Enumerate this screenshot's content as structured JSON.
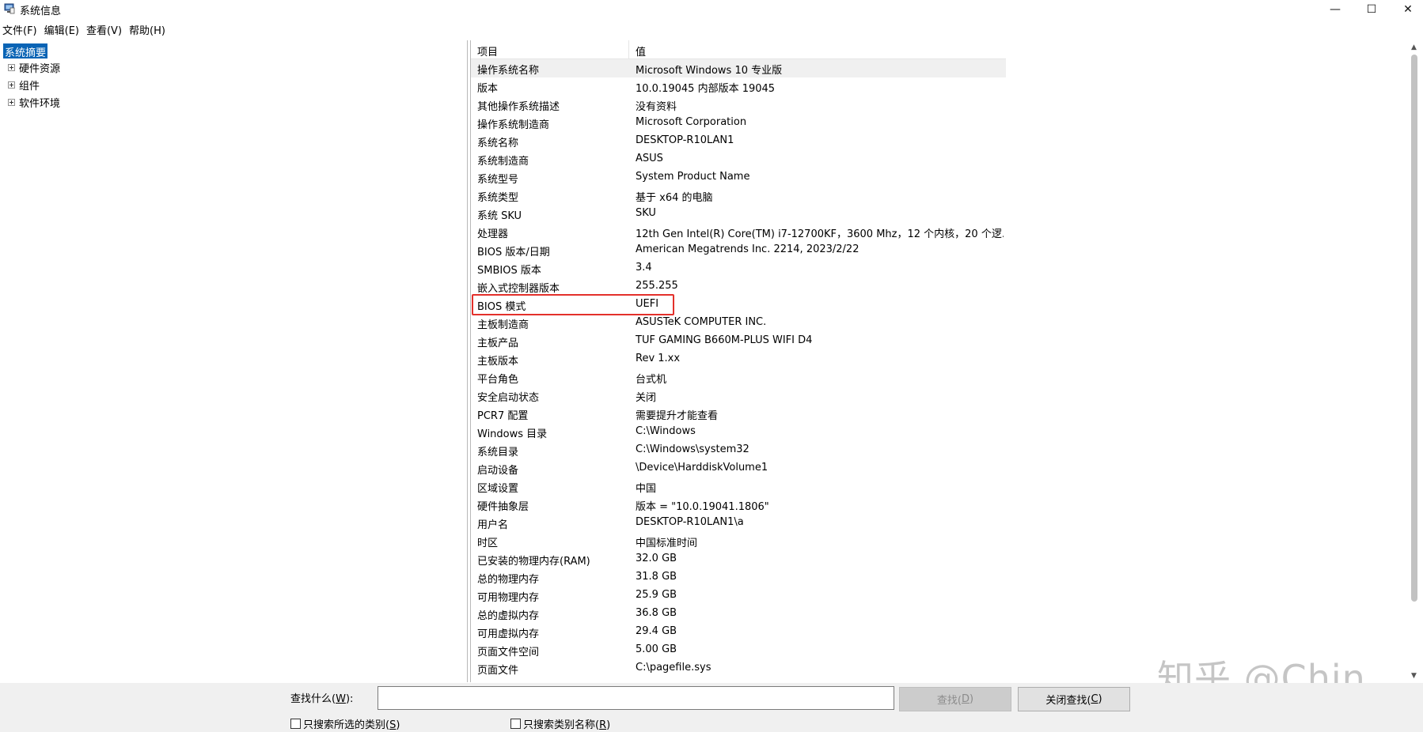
{
  "window": {
    "title": "系统信息",
    "minimize_glyph": "—",
    "maximize_glyph": "☐",
    "close_glyph": "✕"
  },
  "menu": [
    {
      "label": "文件(F)"
    },
    {
      "label": "编辑(E)"
    },
    {
      "label": "查看(V)"
    },
    {
      "label": "帮助(H)"
    }
  ],
  "tree": {
    "root": "系统摘要",
    "nodes": [
      {
        "label": "硬件资源"
      },
      {
        "label": "组件"
      },
      {
        "label": "软件环境"
      }
    ]
  },
  "table": {
    "columns": {
      "item": "项目",
      "value": "值"
    },
    "rows": [
      {
        "item": "操作系统名称",
        "value": "Microsoft Windows 10 专业版"
      },
      {
        "item": "版本",
        "value": "10.0.19045 内部版本 19045"
      },
      {
        "item": "其他操作系统描述",
        "value": "没有资料"
      },
      {
        "item": "操作系统制造商",
        "value": "Microsoft Corporation"
      },
      {
        "item": "系统名称",
        "value": "DESKTOP-R10LAN1"
      },
      {
        "item": "系统制造商",
        "value": "ASUS"
      },
      {
        "item": "系统型号",
        "value": "System Product Name"
      },
      {
        "item": "系统类型",
        "value": "基于 x64 的电脑"
      },
      {
        "item": "系统 SKU",
        "value": "SKU"
      },
      {
        "item": "处理器",
        "value": "12th Gen Intel(R) Core(TM) i7-12700KF，3600 Mhz，12 个内核，20 个逻..."
      },
      {
        "item": "BIOS 版本/日期",
        "value": "American Megatrends Inc. 2214, 2023/2/22"
      },
      {
        "item": "SMBIOS 版本",
        "value": "3.4"
      },
      {
        "item": "嵌入式控制器版本",
        "value": "255.255"
      },
      {
        "item": "BIOS 模式",
        "value": "UEFI"
      },
      {
        "item": "主板制造商",
        "value": "ASUSTeK COMPUTER INC."
      },
      {
        "item": "主板产品",
        "value": "TUF GAMING B660M-PLUS WIFI D4"
      },
      {
        "item": "主板版本",
        "value": "Rev 1.xx"
      },
      {
        "item": "平台角色",
        "value": "台式机"
      },
      {
        "item": "安全启动状态",
        "value": "关闭"
      },
      {
        "item": "PCR7 配置",
        "value": "需要提升才能查看"
      },
      {
        "item": "Windows 目录",
        "value": "C:\\Windows"
      },
      {
        "item": "系统目录",
        "value": "C:\\Windows\\system32"
      },
      {
        "item": "启动设备",
        "value": "\\Device\\HarddiskVolume1"
      },
      {
        "item": "区域设置",
        "value": "中国"
      },
      {
        "item": "硬件抽象层",
        "value": "版本 = \"10.0.19041.1806\""
      },
      {
        "item": "用户名",
        "value": "DESKTOP-R10LAN1\\a"
      },
      {
        "item": "时区",
        "value": "中国标准时间"
      },
      {
        "item": "已安装的物理内存(RAM)",
        "value": "32.0 GB"
      },
      {
        "item": "总的物理内存",
        "value": "31.8 GB"
      },
      {
        "item": "可用物理内存",
        "value": "25.9 GB"
      },
      {
        "item": "总的虚拟内存",
        "value": "36.8 GB"
      },
      {
        "item": "可用虚拟内存",
        "value": "29.4 GB"
      },
      {
        "item": "页面文件空间",
        "value": "5.00 GB"
      },
      {
        "item": "页面文件",
        "value": "C:\\pagefile.sys"
      }
    ]
  },
  "find": {
    "label_prefix": "查找什么(",
    "label_key": "W",
    "label_suffix": "):",
    "input_value": "",
    "find_button_prefix": "查找(",
    "find_button_key": "D",
    "find_button_suffix": ")",
    "close_button_prefix": "关闭查找(",
    "close_button_key": "C",
    "close_button_suffix": ")",
    "checkbox_selected_prefix": "只搜索所选的类别(",
    "checkbox_selected_key": "S",
    "checkbox_selected_suffix": ")",
    "checkbox_selected_checked": false,
    "checkbox_names_prefix": "只搜索类别名称(",
    "checkbox_names_key": "R",
    "checkbox_names_suffix": ")",
    "checkbox_names_checked": false
  },
  "watermark": "知乎 @Chin",
  "colors": {
    "selection": "#0a64b5",
    "highlight_box": "#e3302b"
  }
}
